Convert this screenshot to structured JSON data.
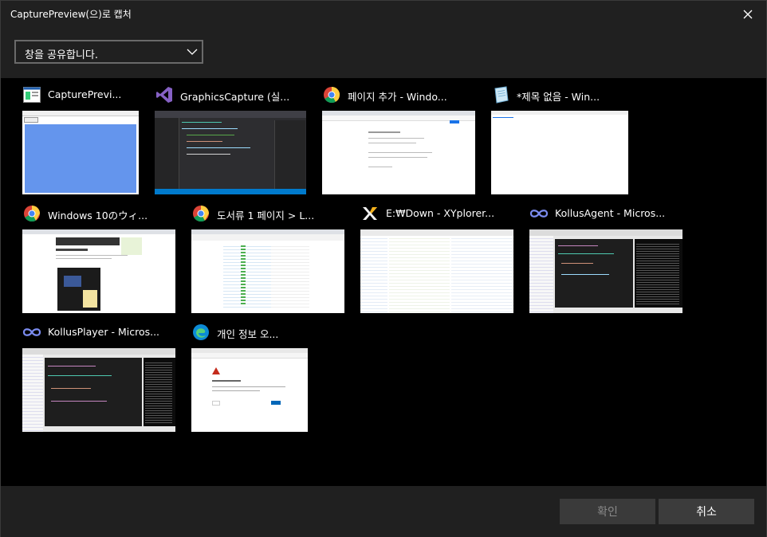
{
  "window": {
    "title": "CapturePreview(으)로 캡처"
  },
  "share_select": {
    "value": "창을 공유합니다."
  },
  "windows": [
    {
      "title": "CapturePrevi...",
      "icon": "app-window-icon"
    },
    {
      "title": "GraphicsCapture (실...",
      "icon": "visual-studio-icon"
    },
    {
      "title": "페이지 추가 - Windo...",
      "icon": "chrome-icon"
    },
    {
      "title": "*제목 없음 - Win...",
      "icon": "notepad-icon"
    },
    {
      "title": "Windows 10のウィ...",
      "icon": "chrome-icon"
    },
    {
      "title": "도서류 1 페이지 > L...",
      "icon": "chrome-icon"
    },
    {
      "title": "E:₩Down - XYplorer...",
      "icon": "xyplorer-icon"
    },
    {
      "title": "KollusAgent - Micros...",
      "icon": "visual-studio-code-icon"
    },
    {
      "title": "KollusPlayer - Micros...",
      "icon": "visual-studio-code-icon"
    },
    {
      "title": "개인 정보 오...",
      "icon": "edge-icon"
    }
  ],
  "buttons": {
    "ok": "확인",
    "cancel": "취소"
  }
}
